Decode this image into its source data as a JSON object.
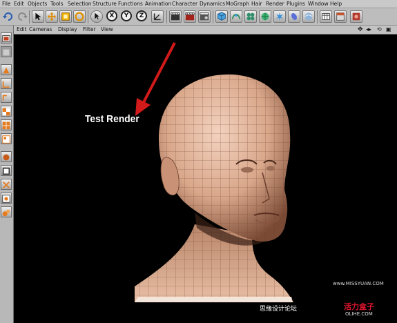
{
  "menu": [
    "File",
    "Edit",
    "Objects",
    "Tools",
    "Selection",
    "Structure",
    "Functions",
    "Animation",
    "Character",
    "Dynamics",
    "MoGraph",
    "Hair",
    "Render",
    "Plugins",
    "Window",
    "Help"
  ],
  "toolbar": {
    "icons": [
      "undo-icon",
      "redo-icon",
      "select-icon",
      "move-icon",
      "scale-icon",
      "rotate-icon",
      "recent-tool-icon",
      "x-axis-icon",
      "y-axis-icon",
      "z-axis-icon",
      "world-coordinates-icon",
      "render-view-icon",
      "render-picture-viewer-icon",
      "render-settings-icon",
      "cube-icon",
      "nurbs-icon",
      "cloner-icon",
      "deformer-icon",
      "light-icon",
      "camera-icon",
      "scene-icon",
      "timeline-icon",
      "material-icon"
    ],
    "axes": [
      "X",
      "Y",
      "Z"
    ]
  },
  "viewport_menu": [
    "Edit",
    "Cameras",
    "Display",
    "Filter",
    "View"
  ],
  "annotation": "Test Render",
  "watermark": {
    "line1": "思缘设计论坛",
    "line2": "www.MISSYUAN.COM",
    "brand": "活力盒子",
    "domain": "OLIHE.COM"
  },
  "colors": {
    "arrow": "#d21a1a",
    "ui_gray": "#bdbdbd",
    "viewport_bg": "#000000",
    "skin": "#d9a78a"
  }
}
